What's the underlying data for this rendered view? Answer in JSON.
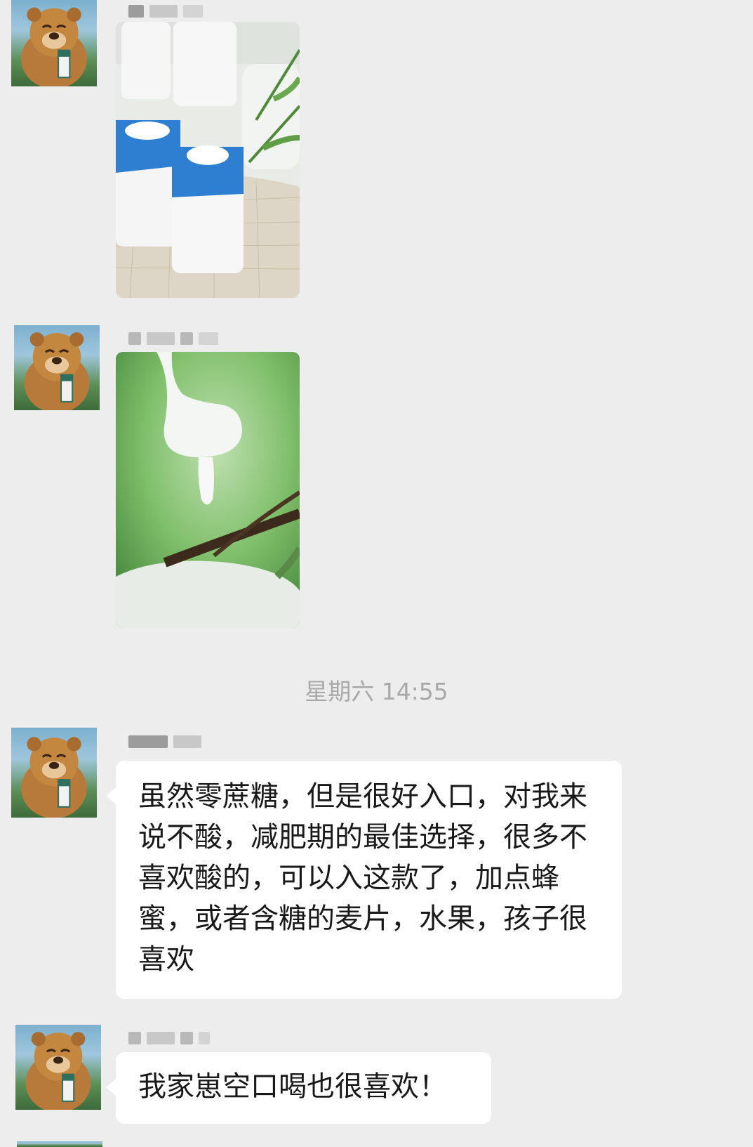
{
  "conversation": {
    "timestamp": "星期六 14:55",
    "messages": [
      {
        "type": "image",
        "content": "yogurt-cups-photo"
      },
      {
        "type": "image",
        "content": "yogurt-spoon-photo"
      },
      {
        "type": "text",
        "text": "虽然零蔗糖，但是很好入口，对我来说不酸，减肥期的最佳选择，很多不喜欢酸的，可以入这款了，加点蜂蜜，或者含糖的麦片，水果，孩子很喜欢"
      },
      {
        "type": "text",
        "text": "我家崽空口喝也很喜欢！"
      }
    ]
  },
  "colors": {
    "background": "#ededed",
    "bubble": "#ffffff",
    "text": "#191919",
    "timestamp": "#a8a8a8"
  }
}
